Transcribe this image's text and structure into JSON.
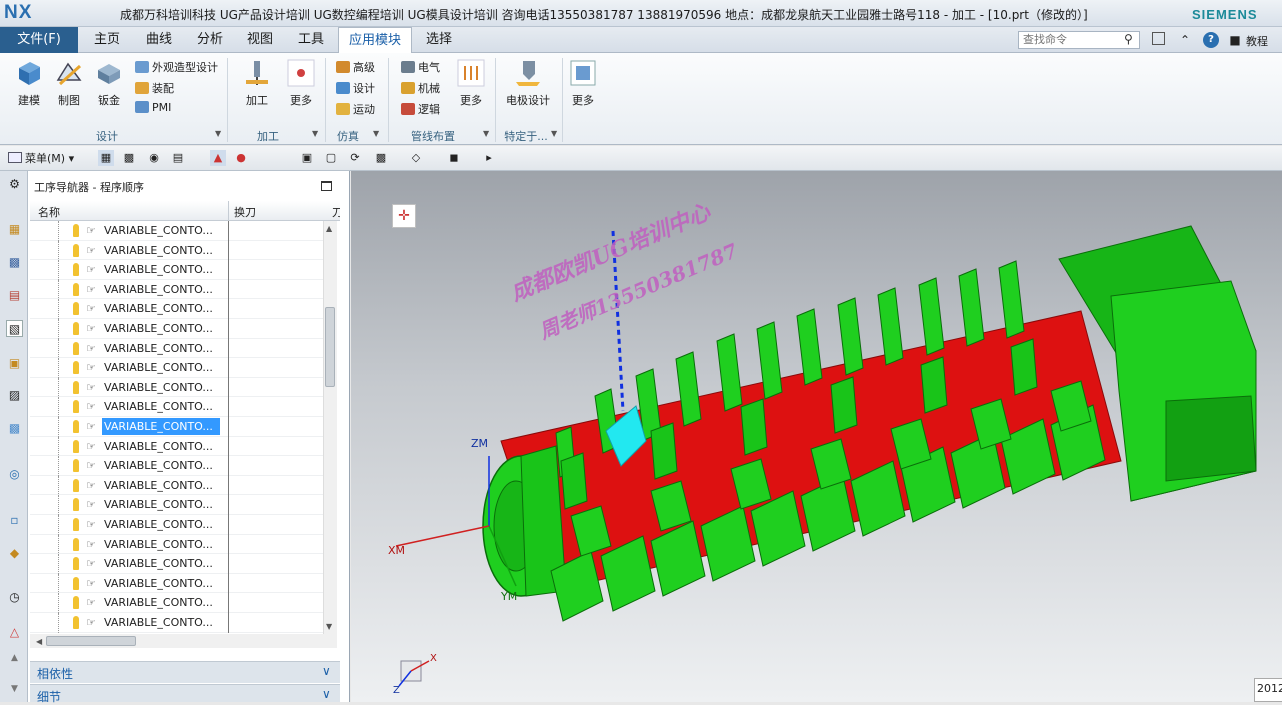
{
  "window": {
    "logo": "NX",
    "title": "成都万科培训科技    UG产品设计培训    UG数控编程培训    UG模具设计培训    咨询电话13550381787    13881970596    地点：成都龙泉航天工业园雅士路号118 - 加工 - [10.prt（修改的）]",
    "brand": "SIEMENS"
  },
  "menu_tabs": [
    "文件(F)",
    "主页",
    "曲线",
    "分析",
    "视图",
    "工具",
    "应用模块",
    "选择"
  ],
  "search": {
    "placeholder": "查找命令"
  },
  "top_right": {
    "learn_label": "教程"
  },
  "ribbon": {
    "design_group": {
      "buttons": [
        "建模",
        "制图",
        "钣金"
      ],
      "small": [
        "外观造型设计",
        "装配",
        "PMI"
      ],
      "label": "设计"
    },
    "machining_group": {
      "buttons": [
        "加工",
        "更多"
      ],
      "label": "加工"
    },
    "simulation_group": {
      "small": [
        "高级",
        "设计",
        "运动"
      ],
      "label": "仿真"
    },
    "piping_group": {
      "small": [
        "电气",
        "机械",
        "逻辑"
      ],
      "more": "更多",
      "label": "管线布置"
    },
    "specific_group": {
      "buttons": [
        "电极设计"
      ],
      "label": "特定于..."
    },
    "more_group": {
      "buttons": [
        "更多"
      ]
    }
  },
  "toolbar2": {
    "menu_label": "菜单(M)"
  },
  "navigator": {
    "title": "工序导航器 - 程序顺序",
    "columns": [
      "名称",
      "换刀",
      "刀"
    ],
    "rows": [
      "VARIABLE_CONTO...",
      "VARIABLE_CONTO...",
      "VARIABLE_CONTO...",
      "VARIABLE_CONTO...",
      "VARIABLE_CONTO...",
      "VARIABLE_CONTO...",
      "VARIABLE_CONTO...",
      "VARIABLE_CONTO...",
      "VARIABLE_CONTO...",
      "VARIABLE_CONTO...",
      "VARIABLE_CONTO...",
      "VARIABLE_CONTO...",
      "VARIABLE_CONTO...",
      "VARIABLE_CONTO...",
      "VARIABLE_CONTO...",
      "VARIABLE_CONTO...",
      "VARIABLE_CONTO...",
      "VARIABLE_CONTO...",
      "VARIABLE_CONTO...",
      "VARIABLE_CONTO...",
      "VARIABLE_CONTO..."
    ],
    "selected_index": 10,
    "dependency_label": "相依性",
    "details_label": "细节"
  },
  "viewport": {
    "watermark_line1": "成都欧凯UG培训中心",
    "watermark_line2": "周老师13550381787",
    "axis_zm": "ZM",
    "axis_xm": "XM",
    "axis_ym": "YM",
    "triad_x": "X",
    "triad_z": "Z",
    "corner_badge": "2012"
  },
  "colors": {
    "part_green": "#19c419",
    "core_red": "#dd1111",
    "toolpath_cyan": "#22e8f0",
    "path_blue": "#1030e0",
    "accent": "#1a5fa8"
  }
}
